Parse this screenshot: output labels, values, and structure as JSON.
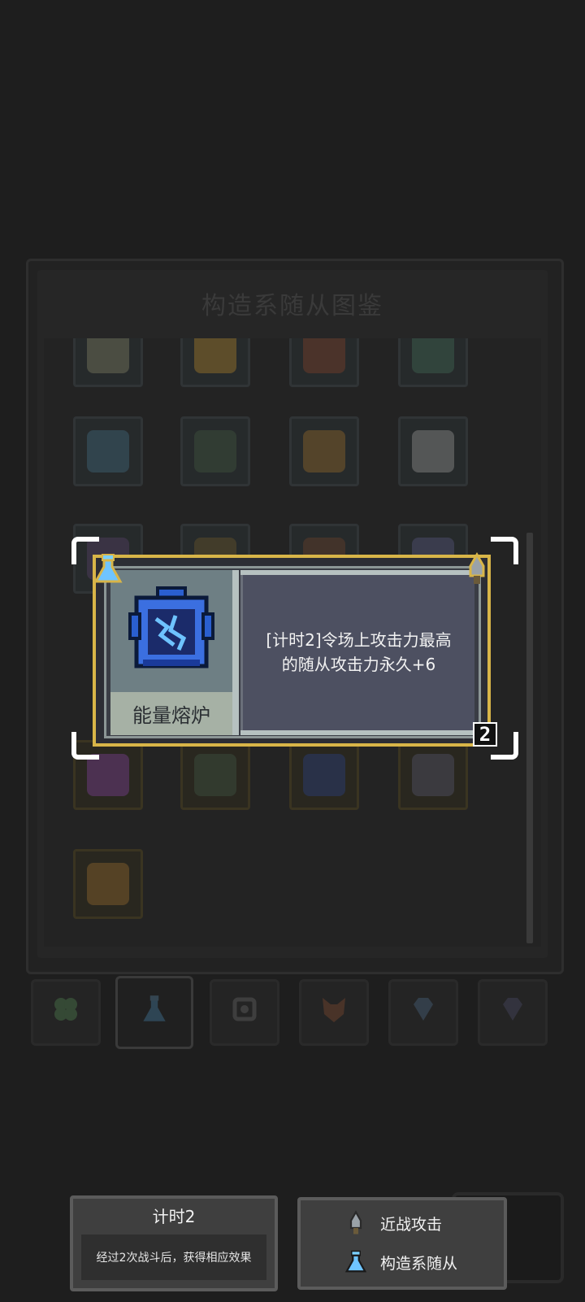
{
  "collection": {
    "title": "构造系随从图鉴"
  },
  "tabs": [
    {
      "icon": "clover-icon"
    },
    {
      "icon": "flask-icon",
      "active": true
    },
    {
      "icon": "gear-icon"
    },
    {
      "icon": "fox-icon"
    },
    {
      "icon": "diamond-icon"
    },
    {
      "icon": "diamond-icon"
    }
  ],
  "card": {
    "name": "能量熔炉",
    "description_line1": "[计时2]令场上攻击力最高",
    "description_line2": "的随从攻击力永久+6",
    "cost": "2",
    "type_icon": "flask-icon",
    "attack_icon": "sword-icon",
    "accent_color": "#d8b548"
  },
  "keyword": {
    "title": "计时2",
    "description": "经过2次战斗后，获得相应效果"
  },
  "legend": {
    "melee_label": "近战攻击",
    "construct_label": "构造系随从"
  }
}
